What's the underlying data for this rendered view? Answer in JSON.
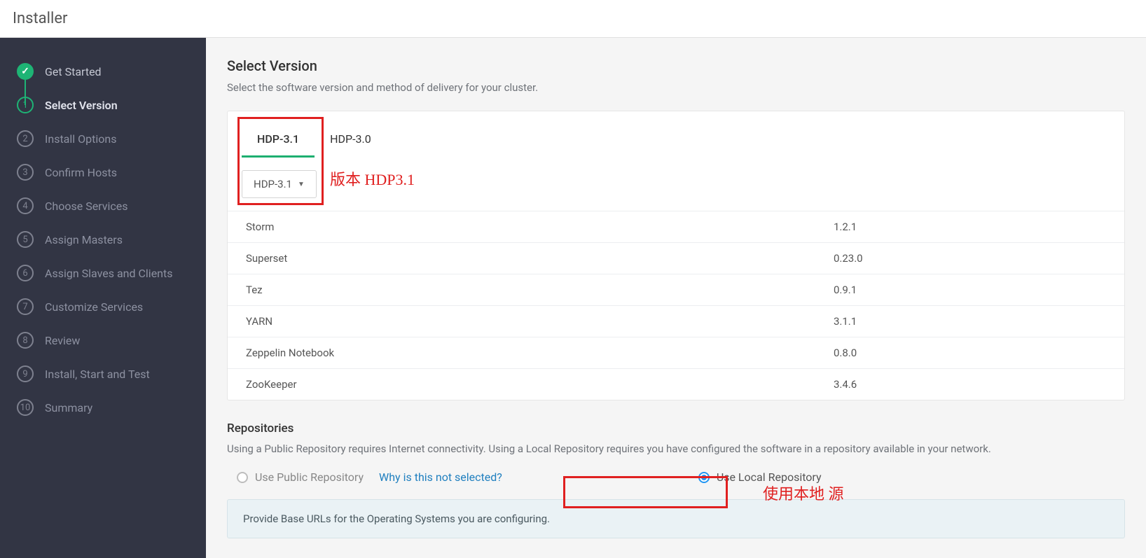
{
  "header": {
    "title": "Installer"
  },
  "sidebar": {
    "steps": [
      {
        "num": "",
        "label": "Get Started",
        "state": "done"
      },
      {
        "num": "1",
        "label": "Select Version",
        "state": "current"
      },
      {
        "num": "2",
        "label": "Install Options",
        "state": "pending"
      },
      {
        "num": "3",
        "label": "Confirm Hosts",
        "state": "pending"
      },
      {
        "num": "4",
        "label": "Choose Services",
        "state": "pending"
      },
      {
        "num": "5",
        "label": "Assign Masters",
        "state": "pending"
      },
      {
        "num": "6",
        "label": "Assign Slaves and Clients",
        "state": "pending"
      },
      {
        "num": "7",
        "label": "Customize Services",
        "state": "pending"
      },
      {
        "num": "8",
        "label": "Review",
        "state": "pending"
      },
      {
        "num": "9",
        "label": "Install, Start and Test",
        "state": "pending"
      },
      {
        "num": "10",
        "label": "Summary",
        "state": "pending"
      }
    ]
  },
  "main": {
    "title": "Select Version",
    "desc": "Select the software version and method of delivery for your cluster.",
    "tabs": [
      {
        "label": "HDP-3.1",
        "active": true
      },
      {
        "label": "HDP-3.0",
        "active": false
      }
    ],
    "dropdown": "HDP-3.1",
    "services": [
      {
        "name": "Storm",
        "version": "1.2.1"
      },
      {
        "name": "Superset",
        "version": "0.23.0"
      },
      {
        "name": "Tez",
        "version": "0.9.1"
      },
      {
        "name": "YARN",
        "version": "3.1.1"
      },
      {
        "name": "Zeppelin Notebook",
        "version": "0.8.0"
      },
      {
        "name": "ZooKeeper",
        "version": "3.4.6"
      }
    ],
    "repositories": {
      "title": "Repositories",
      "desc": "Using a Public Repository requires Internet connectivity. Using a Local Repository requires you have configured the software in a repository available in your network.",
      "public_label": "Use Public Repository",
      "why_link": "Why is this not selected?",
      "local_label": "Use Local Repository",
      "selected": "local",
      "info": "Provide Base URLs for the Operating Systems you are configuring."
    }
  },
  "annotations": {
    "version_text": "版本 HDP3.1",
    "local_repo_text": "使用本地 源"
  }
}
